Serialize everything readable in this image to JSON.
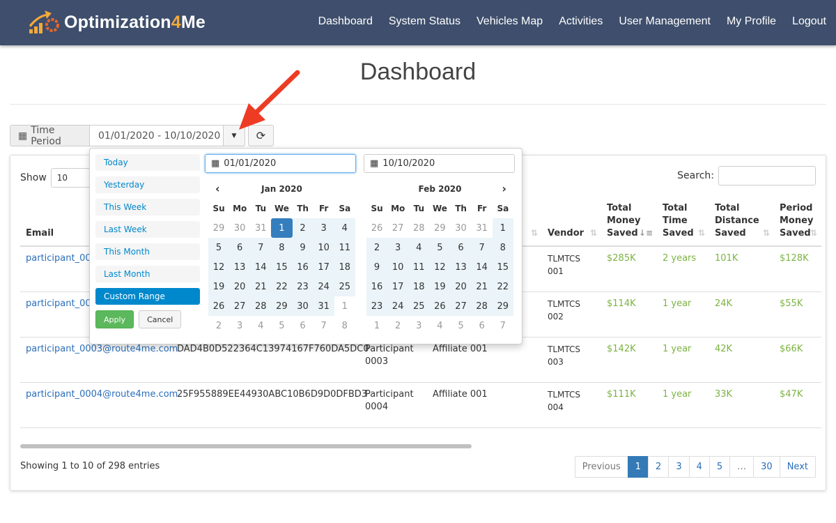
{
  "header": {
    "brand_main": "Optimization",
    "brand_four": "4",
    "brand_me": "Me",
    "nav": [
      "Dashboard",
      "System Status",
      "Vehicles Map",
      "Activities",
      "User Management",
      "My Profile",
      "Logout"
    ]
  },
  "page_title": "Dashboard",
  "time_period": {
    "label": "Time Period",
    "value": "01/01/2020 - 10/10/2020"
  },
  "table_controls": {
    "show_label": "Show",
    "show_value": "10",
    "search_label": "Search:",
    "search_value": ""
  },
  "columns": [
    {
      "label": "Email"
    },
    {
      "label": ""
    },
    {
      "label": ""
    },
    {
      "label": ""
    },
    {
      "label": ""
    },
    {
      "label": "Vendor"
    },
    {
      "label": "Total Money Saved"
    },
    {
      "label": "Total Time Saved"
    },
    {
      "label": "Total Distance Saved"
    },
    {
      "label": "Period Money Saved"
    }
  ],
  "rows": [
    {
      "email": "participant_0001@route4me.com",
      "token": "",
      "name": "",
      "affiliate": "",
      "vendor": "TLMTCS 001",
      "money": "$285K",
      "time": "2 years",
      "distance": "101K",
      "period": "$128K"
    },
    {
      "email": "participant_0002@route4me.com",
      "token": "",
      "name": "",
      "affiliate": "",
      "vendor": "TLMTCS 002",
      "money": "$114K",
      "time": "1 year",
      "distance": "24K",
      "period": "$55K"
    },
    {
      "email": "participant_0003@route4me.com",
      "token": "DAD4B0D522364C13974167F760DA5DC0",
      "name": "Participant 0003",
      "affiliate": "Affiliate 001",
      "vendor": "TLMTCS 003",
      "money": "$142K",
      "time": "1 year",
      "distance": "42K",
      "period": "$66K"
    },
    {
      "email": "participant_0004@route4me.com",
      "token": "25F955889EE44930ABC10B6D9D0DFBD3",
      "name": "Participant 0004",
      "affiliate": "Affiliate 001",
      "vendor": "TLMTCS 004",
      "money": "$111K",
      "time": "1 year",
      "distance": "33K",
      "period": "$47K"
    }
  ],
  "footer": {
    "info": "Showing 1 to 10 of 298 entries",
    "pages": [
      "Previous",
      "1",
      "2",
      "3",
      "4",
      "5",
      "…",
      "30",
      "Next"
    ],
    "active_page": "1"
  },
  "picker": {
    "ranges": [
      "Today",
      "Yesterday",
      "This Week",
      "Last Week",
      "This Month",
      "Last Month",
      "Custom Range"
    ],
    "active_range": "Custom Range",
    "apply": "Apply",
    "cancel": "Cancel",
    "start_input": "01/01/2020",
    "end_input": "10/10/2020",
    "weekdays": [
      "Su",
      "Mo",
      "Tu",
      "We",
      "Th",
      "Fr",
      "Sa"
    ],
    "left": {
      "month": "Jan 2020",
      "selected": "1",
      "weeks": [
        [
          29,
          30,
          31,
          1,
          2,
          3,
          4
        ],
        [
          5,
          6,
          7,
          8,
          9,
          10,
          11
        ],
        [
          12,
          13,
          14,
          15,
          16,
          17,
          18
        ],
        [
          19,
          20,
          21,
          22,
          23,
          24,
          25
        ],
        [
          26,
          27,
          28,
          29,
          30,
          31,
          1
        ],
        [
          2,
          3,
          4,
          5,
          6,
          7,
          8
        ]
      ]
    },
    "right": {
      "month": "Feb 2020",
      "selected": "",
      "weeks": [
        [
          26,
          27,
          28,
          29,
          30,
          31,
          1
        ],
        [
          2,
          3,
          4,
          5,
          6,
          7,
          8
        ],
        [
          9,
          10,
          11,
          12,
          13,
          14,
          15
        ],
        [
          16,
          17,
          18,
          19,
          20,
          21,
          22
        ],
        [
          23,
          24,
          25,
          26,
          27,
          28,
          29
        ],
        [
          1,
          2,
          3,
          4,
          5,
          6,
          7
        ]
      ]
    }
  },
  "colors": {
    "header_bg": "#3e4e6c",
    "accent": "#f3a93a",
    "link": "#2a6ebb",
    "positive": "#7cb342",
    "selected": "#357ebd",
    "annotation_arrow": "#ee3b24"
  }
}
